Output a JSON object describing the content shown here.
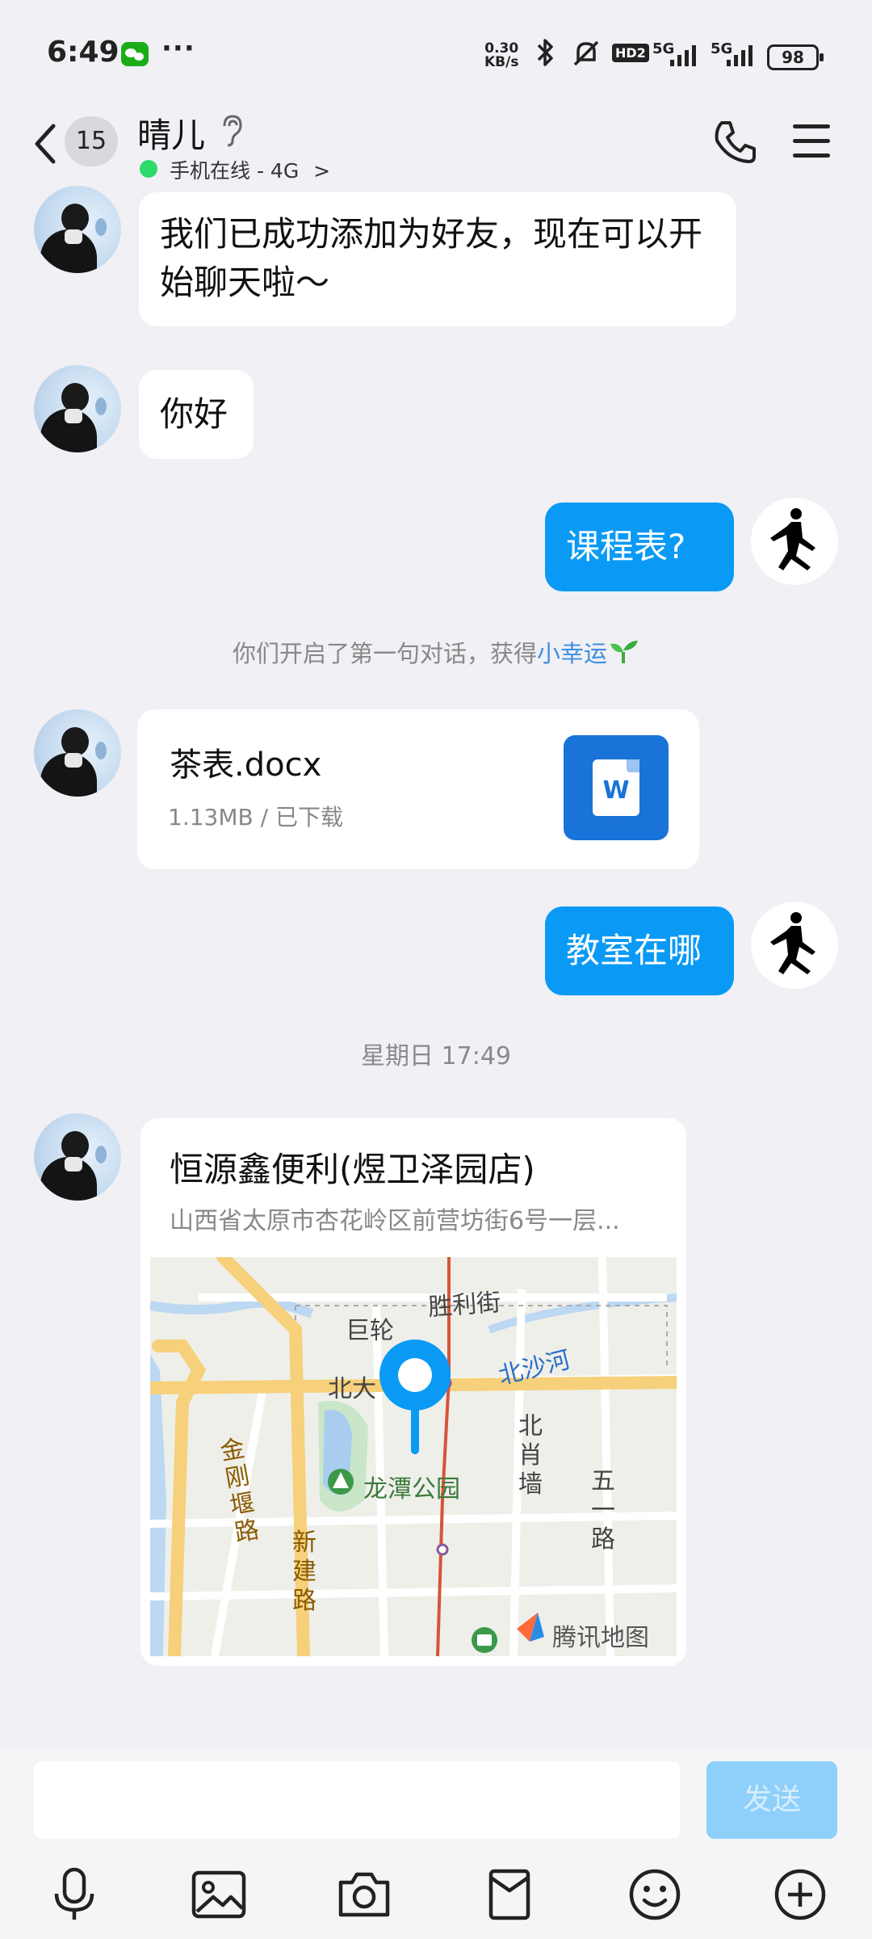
{
  "status": {
    "time": "6:49",
    "more": "···",
    "speed_top": "0.30",
    "speed_bottom": "KB/s",
    "hd": "HD2",
    "net1": "5G",
    "net2": "5G",
    "battery": "98"
  },
  "header": {
    "unread_count": "15",
    "title": "晴儿",
    "online_status": "手机在线 - 4G"
  },
  "messages": {
    "m1": "我们已成功添加为好友，现在可以开始聊天啦～",
    "m2": "你好",
    "m3": "课程表?",
    "m5": "教室在哪"
  },
  "system_note": {
    "text": "你们开启了第一句对话，获得",
    "link": "小幸运"
  },
  "file": {
    "name": "茶表.docx",
    "meta": "1.13MB / 已下载",
    "icon_letter": "W"
  },
  "timestamp": "星期日 17:49",
  "location": {
    "name": "恒源鑫便利(煜卫泽园店)",
    "address": "山西省太原市杏花岭区前营坊街6号一层...",
    "map_labels": {
      "shengli": "胜利街",
      "julun": "巨轮",
      "beida": "北大",
      "beisha": "北沙河",
      "jingang": "金刚堰路",
      "longtan": "龙潭公园",
      "beixiao": "北肖墙",
      "wuyi": "五一路",
      "xinjian": "新建路",
      "tencent": "腾讯地图"
    }
  },
  "composer": {
    "send_label": "发送"
  },
  "colors": {
    "accent": "#0a9af5",
    "send_disabled": "#8fd0fb",
    "online": "#2ed96c"
  }
}
